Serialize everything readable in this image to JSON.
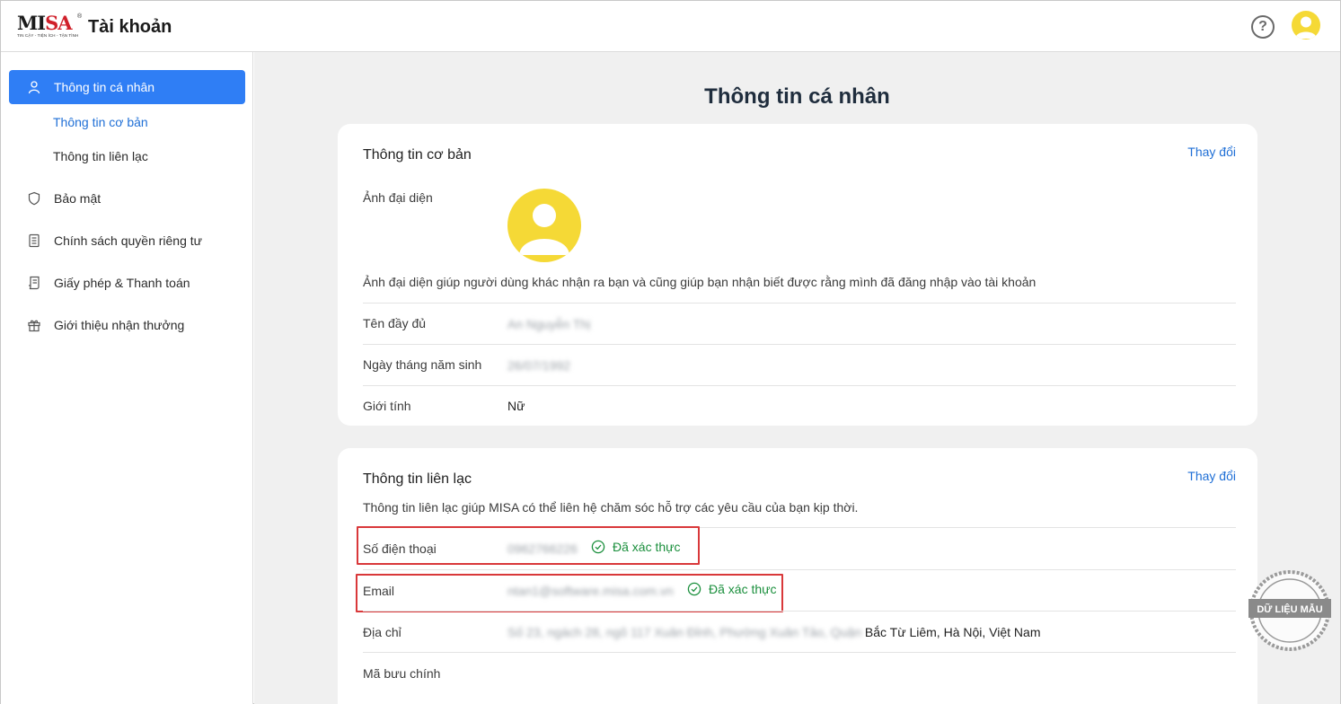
{
  "header": {
    "logo_text_1": "MI",
    "logo_text_2": "SA",
    "logo_tagline": "TIN CẬY - TIỆN ÍCH - TẬN TÌNH",
    "title": "Tài khoản",
    "help_label": "?"
  },
  "sidebar": {
    "items": [
      {
        "label": "Thông tin cá nhân",
        "icon": "user-icon",
        "active": true
      },
      {
        "label": "Bảo mật",
        "icon": "shield-icon"
      },
      {
        "label": "Chính sách quyền riêng tư",
        "icon": "document-icon"
      },
      {
        "label": "Giấy phép & Thanh toán",
        "icon": "receipt-icon"
      },
      {
        "label": "Giới thiệu nhận thưởng",
        "icon": "gift-icon"
      }
    ],
    "subitems": [
      {
        "label": "Thông tin cơ bản",
        "current": true
      },
      {
        "label": "Thông tin liên lạc"
      }
    ]
  },
  "main": {
    "page_title": "Thông tin cá nhân",
    "basic": {
      "title": "Thông tin cơ bản",
      "change_label": "Thay đổi",
      "avatar_label": "Ảnh đại diện",
      "avatar_note": "Ảnh đại diện giúp người dùng khác nhận ra bạn và cũng giúp bạn nhận biết được rằng mình đã đăng nhập vào tài khoản",
      "fields": [
        {
          "label": "Tên đầy đủ",
          "value": "An Nguyễn Thị",
          "blurred": true
        },
        {
          "label": "Ngày tháng năm sinh",
          "value": "26/07/1992",
          "blurred": true
        },
        {
          "label": "Giới tính",
          "value": "Nữ",
          "blurred": false
        }
      ]
    },
    "contact": {
      "title": "Thông tin liên lạc",
      "change_label": "Thay đổi",
      "note": "Thông tin liên lạc giúp MISA có thể liên hệ chăm sóc hỗ trợ các yêu cầu của bạn kịp thời.",
      "phone": {
        "label": "Số điện thoại",
        "value": "0962766226",
        "status": "Đã xác thực"
      },
      "email": {
        "label": "Email",
        "value": "ntan1@software.misa.com.vn",
        "status": "Đã xác thực"
      },
      "address": {
        "label": "Địa chỉ",
        "value_blurred": "Số 23, ngách 28, ngõ 117 Xuân Đỉnh, Phường Xuân Tảo, Quận",
        "value_clear": "Bắc Từ Liêm, Hà Nội, Việt Nam"
      },
      "postal": {
        "label": "Mã bưu chính",
        "value": ""
      }
    }
  },
  "stamp": {
    "text": "DỮ LIỆU MẪU"
  },
  "colors": {
    "accent": "#2f7ef5",
    "link": "#1f6fd6",
    "verified": "#1a8f3c",
    "avatar": "#f5d936",
    "highlight_box": "#d9383a",
    "main_bg": "#f0f0f0"
  }
}
